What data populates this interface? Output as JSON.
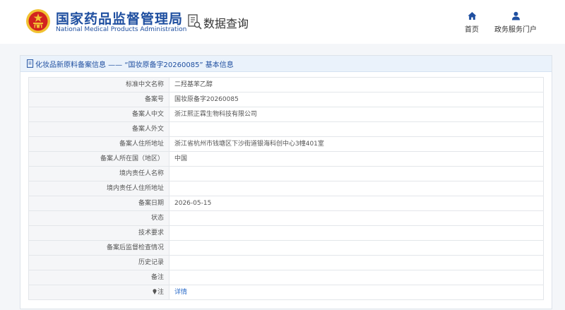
{
  "header": {
    "logo_cn": "国家药品监督管理局",
    "logo_en": "National Medical Products Administration",
    "section_title": "数据查询",
    "nav": [
      {
        "label": "首页",
        "icon": "home-icon"
      },
      {
        "label": "政务服务门户",
        "icon": "user-icon"
      }
    ]
  },
  "panel": {
    "title": "化妆品新原料备案信息 —— “国妆原备字20260085” 基本信息",
    "rows": [
      {
        "label": "标准中文名称",
        "value": "二羟基苯乙醇"
      },
      {
        "label": "备案号",
        "value": "国妆原备字20260085"
      },
      {
        "label": "备案人中文",
        "value": "浙江熙正霖生物科技有限公司"
      },
      {
        "label": "备案人外文",
        "value": ""
      },
      {
        "label": "备案人住所地址",
        "value": "浙江省杭州市钱塘区下沙街道银海科创中心3幢401室"
      },
      {
        "label": "备案人所在国（地区）",
        "value": "中国"
      },
      {
        "label": "境内责任人名称",
        "value": ""
      },
      {
        "label": "境内责任人住所地址",
        "value": ""
      },
      {
        "label": "备案日期",
        "value": "2026-05-15"
      },
      {
        "label": "状态",
        "value": ""
      },
      {
        "label": "技术要求",
        "value": ""
      },
      {
        "label": "备案后监督检查情况",
        "value": ""
      },
      {
        "label": "历史记录",
        "value": ""
      },
      {
        "label": "备注",
        "value": ""
      }
    ],
    "note_row": {
      "label": "注",
      "link": "详情"
    }
  },
  "colors": {
    "brand_blue": "#1f4fa0",
    "link_blue": "#2a6bc9",
    "emblem_red": "#d2231f",
    "emblem_gold": "#f1c232"
  }
}
